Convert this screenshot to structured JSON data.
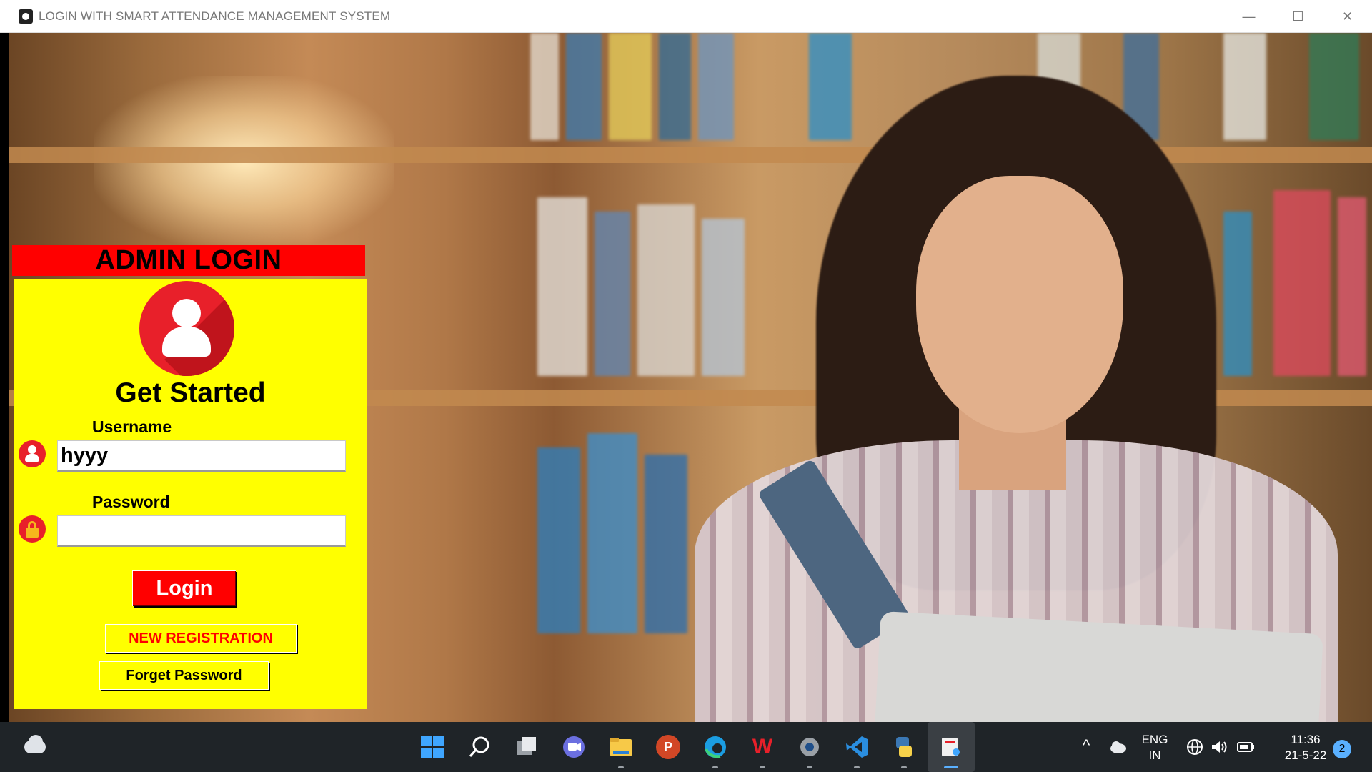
{
  "window": {
    "title": "LOGIN WITH SMART ATTENDANCE MANAGEMENT SYSTEM",
    "minimize_glyph": "—",
    "maximize_glyph": "☐",
    "close_glyph": "✕"
  },
  "login": {
    "header": "ADMIN LOGIN",
    "heading": "Get Started",
    "username_label": "Username",
    "username_value": "hyyy",
    "password_label": "Password",
    "password_value": "",
    "login_button": "Login",
    "new_registration_button": "NEW REGISTRATION",
    "forget_password_button": "Forget Password"
  },
  "taskbar": {
    "apps": [
      {
        "icon": "windows-start-icon"
      },
      {
        "icon": "search-icon"
      },
      {
        "icon": "task-view-icon"
      },
      {
        "icon": "teams-chat-icon"
      },
      {
        "icon": "file-explorer-icon"
      },
      {
        "icon": "powerpoint-icon",
        "letter": "P"
      },
      {
        "icon": "edge-icon"
      },
      {
        "icon": "wps-office-icon",
        "letter": "W"
      },
      {
        "icon": "settings-icon"
      },
      {
        "icon": "vscode-icon"
      },
      {
        "icon": "python-icon"
      },
      {
        "icon": "snipping-tool-icon"
      }
    ],
    "language_line1": "ENG",
    "language_line2": "IN",
    "time": "11:36",
    "date": "21-5-22",
    "notification_count": "2",
    "overflow_glyph": "^"
  },
  "colors": {
    "header_red": "#ff0000",
    "panel_yellow": "#ffff00",
    "avatar_red": "#e8202a",
    "taskbar_bg": "#1f2428"
  }
}
